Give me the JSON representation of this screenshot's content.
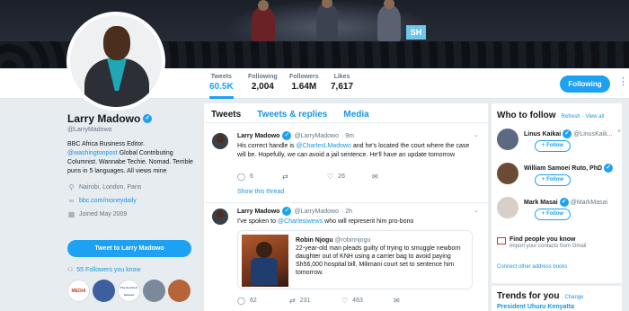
{
  "stats": [
    {
      "label": "Tweets",
      "value": "60.5K"
    },
    {
      "label": "Following",
      "value": "2,004"
    },
    {
      "label": "Followers",
      "value": "1.64M"
    },
    {
      "label": "Likes",
      "value": "7,617"
    }
  ],
  "banner_sign": "SH",
  "header": {
    "follow_button": "Following"
  },
  "profile": {
    "name": "Larry Madowo",
    "handle": "@LarryMadowo",
    "bio_1": "BBC Africa Business Editor.",
    "bio_mention": "@washingtonpost",
    "bio_2": " Global Contributing Columnist. Wannabe Techie. Nomad. Terrible puns in 5 languages. All views mine",
    "location": "Nairobi, London, Paris",
    "website": "bbc.com/moneydaily",
    "joined": "Joined May 2009",
    "tweet_to": "Tweet to Larry Madowo",
    "followers_you_know": "55 Followers you know",
    "mini_avatars": [
      "MEDIA",
      "",
      "The Sound of Science",
      "",
      ""
    ]
  },
  "tabs": [
    "Tweets",
    "Tweets & replies",
    "Media"
  ],
  "tweets": [
    {
      "name": "Larry Madowo",
      "handle": "@LarryMadowo",
      "time": "· 9m",
      "text_1": "His correct handle is ",
      "mention": "@CharlesLMadowo",
      "text_2": " and he's located the court where the case will be. Hopefully, we can avoid a jail sentence. He'll have an update tomorrow",
      "replies": "6",
      "retweets": "",
      "likes": "26",
      "show_thread": "Show this thread"
    },
    {
      "name": "Larry Madowo",
      "handle": "@LarryMadowo",
      "time": "· 2h",
      "text_1": "I've spoken to ",
      "mention": "@Charlesiwews",
      "text_2": " who will represent him pro-bono",
      "replies": "62",
      "retweets": "231",
      "likes": "463",
      "card": {
        "name": "Robin Njogu",
        "handle": "@robinnjogu",
        "text": "22-year-old man pleads guilty of trying to smuggle newborn daughter out of KNH using a carrier bag to avoid paying Sh56,000 hospital bill, Milimani court set to sentence him tomorrow."
      }
    }
  ],
  "who_to_follow": {
    "title": "Who to follow",
    "refresh": "Refresh",
    "view_all": "View all",
    "follow_label": "Follow",
    "suggestions": [
      {
        "name": "Linus Kaikai",
        "handle": "@LinusKaik..."
      },
      {
        "name": "William Samoei Ruto, PhD",
        "handle": ""
      },
      {
        "name": "Mark Masai",
        "handle": "@MarkMasai"
      }
    ],
    "find_title": "Find people you know",
    "find_sub": "Import your contacts from Gmail",
    "other_books": "Connect other address books"
  },
  "trends": {
    "title": "Trends for you",
    "change": "Change",
    "first": "President Uhuru Kenyatta"
  },
  "colors": {
    "accent": "#1da1f2",
    "link": "#1b95e0",
    "background": "#e6ecf0"
  }
}
